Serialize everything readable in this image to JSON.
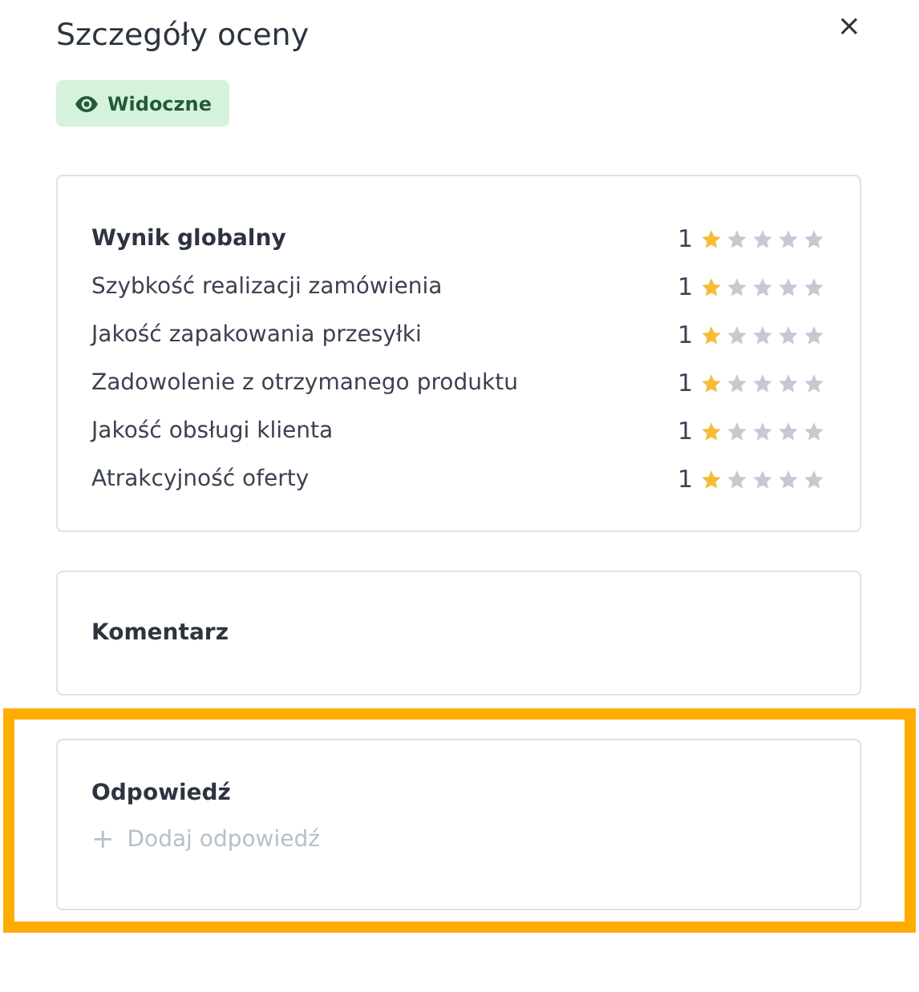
{
  "title": "Szczegóły oceny",
  "close_label": "×",
  "badge": {
    "label": "Widoczne",
    "visible": true
  },
  "ratings": [
    {
      "label": "Wynik globalny",
      "score": "1",
      "stars": 1,
      "emphasized": true
    },
    {
      "label": "Szybkość realizacji zamówienia",
      "score": "1",
      "stars": 1,
      "emphasized": false
    },
    {
      "label": "Jakość zapakowania przesyłki",
      "score": "1",
      "stars": 1,
      "emphasized": false
    },
    {
      "label": "Zadowolenie z otrzymanego produktu",
      "score": "1",
      "stars": 1,
      "emphasized": false
    },
    {
      "label": "Jakość obsługi klienta",
      "score": "1",
      "stars": 1,
      "emphasized": false
    },
    {
      "label": "Atrakcyjność oferty",
      "score": "1",
      "stars": 1,
      "emphasized": false
    }
  ],
  "comment": {
    "heading": "Komentarz"
  },
  "reply": {
    "heading": "Odpowiedź",
    "add_icon": "+",
    "add_label": "Dodaj odpowiedź",
    "highlighted": true
  }
}
